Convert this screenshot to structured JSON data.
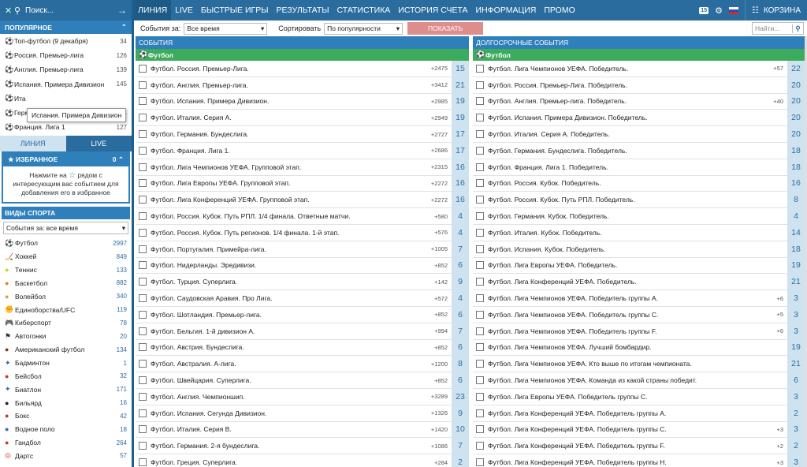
{
  "search": {
    "placeholder": "Поиск..."
  },
  "popular": {
    "title": "ПОПУЛЯРНОЕ",
    "items": [
      {
        "name": "Топ-футбол (9 декабря)",
        "count": "34"
      },
      {
        "name": "Россия. Премьер-лига",
        "count": "126"
      },
      {
        "name": "Англия. Премьер-лига",
        "count": "139"
      },
      {
        "name": "Испания. Примера Дивизион",
        "count": "145"
      },
      {
        "name": "Ита",
        "count": ""
      },
      {
        "name": "Германия. Бундеслига",
        "count": "134"
      },
      {
        "name": "Франция. Лига 1",
        "count": "127"
      }
    ],
    "tooltip": "Испания. Примера Дивизион"
  },
  "side_tabs": {
    "line": "ЛИНИЯ",
    "live": "LIVE"
  },
  "favorites": {
    "title": "ИЗБРАННОЕ",
    "count": "0",
    "text_a": "Нажмите на",
    "text_b": "рядом с интересующим вас событием для добавления его в избранное"
  },
  "sports": {
    "title": "ВИДЫ СПОРТА",
    "period": "События за: все время",
    "items": [
      {
        "name": "Футбол",
        "count": "2997",
        "icon": "⚽",
        "color": "#2fa34b"
      },
      {
        "name": "Хоккей",
        "count": "849",
        "icon": "🏒",
        "color": "#2e6da4"
      },
      {
        "name": "Теннис",
        "count": "133",
        "icon": "●",
        "color": "#c9d52b"
      },
      {
        "name": "Баскетбол",
        "count": "882",
        "icon": "●",
        "color": "#e8821e"
      },
      {
        "name": "Волейбол",
        "count": "340",
        "icon": "●",
        "color": "#d8a23c"
      },
      {
        "name": "Единоборства/UFC",
        "count": "119",
        "icon": "✊",
        "color": "#c0392b"
      },
      {
        "name": "Киберспорт",
        "count": "78",
        "icon": "🎮",
        "color": "#c0392b"
      },
      {
        "name": "Автогонки",
        "count": "20",
        "icon": "⚑",
        "color": "#333"
      },
      {
        "name": "Американский футбол",
        "count": "134",
        "icon": "●",
        "color": "#7a3b1e"
      },
      {
        "name": "Бадминтон",
        "count": "1",
        "icon": "✦",
        "color": "#2e6da4"
      },
      {
        "name": "Бейсбол",
        "count": "32",
        "icon": "●",
        "color": "#c0392b"
      },
      {
        "name": "Биатлон",
        "count": "171",
        "icon": "✦",
        "color": "#2e6da4"
      },
      {
        "name": "Бильярд",
        "count": "16",
        "icon": "●",
        "color": "#222"
      },
      {
        "name": "Бокс",
        "count": "42",
        "icon": "●",
        "color": "#c0392b"
      },
      {
        "name": "Водное поло",
        "count": "18",
        "icon": "●",
        "color": "#2e6da4"
      },
      {
        "name": "Гандбол",
        "count": "264",
        "icon": "●",
        "color": "#c0392b"
      },
      {
        "name": "Дартс",
        "count": "57",
        "icon": "◎",
        "color": "#c0392b"
      }
    ]
  },
  "topnav": {
    "items": [
      "ЛИНИЯ",
      "LIVE",
      "БЫСТРЫЕ ИГРЫ",
      "РЕЗУЛЬТАТЫ",
      "СТАТИСТИКА",
      "ИСТОРИЯ СЧЕТА",
      "ИНФОРМАЦИЯ",
      "ПРОМО"
    ],
    "badge": "15",
    "cart": "КОРЗИНА"
  },
  "filter": {
    "events_label": "События за:",
    "events_value": "Все время",
    "sort_label": "Сортировать",
    "sort_value": "По популярности",
    "show_button": "ПОКАЗАТЬ",
    "search_placeholder": "Найти..."
  },
  "events": {
    "title": "СОБЫТИЯ",
    "sport": "Футбол",
    "rows": [
      {
        "name": "Футбол. Россия. Премьер-Лига.",
        "plus": "+2475",
        "count": "15"
      },
      {
        "name": "Футбол. Англия. Премьер-лига.",
        "plus": "+3412",
        "count": "21"
      },
      {
        "name": "Футбол. Испания. Примера Дивизион.",
        "plus": "+2985",
        "count": "19"
      },
      {
        "name": "Футбол. Италия. Серия А.",
        "plus": "+2949",
        "count": "19"
      },
      {
        "name": "Футбол. Германия. Бундеслига.",
        "plus": "+2727",
        "count": "17"
      },
      {
        "name": "Футбол. Франция. Лига 1.",
        "plus": "+2686",
        "count": "17"
      },
      {
        "name": "Футбол. Лига Чемпионов УЕФА. Групповой этап.",
        "plus": "+2315",
        "count": "16"
      },
      {
        "name": "Футбол. Лига Европы УЕФА. Групповой этап.",
        "plus": "+2272",
        "count": "16"
      },
      {
        "name": "Футбол. Лига Конференций УЕФА. Групповой этап.",
        "plus": "+2272",
        "count": "16"
      },
      {
        "name": "Футбол. Россия. Кубок. Путь РПЛ. 1/4 финала. Ответные матчи.",
        "plus": "+580",
        "count": "4"
      },
      {
        "name": "Футбол. Россия. Кубок. Путь регионов. 1/4 финала. 1-й этап.",
        "plus": "+576",
        "count": "4"
      },
      {
        "name": "Футбол. Португалия. Примейра-лига.",
        "plus": "+1005",
        "count": "7"
      },
      {
        "name": "Футбол. Нидерланды. Эредивизи.",
        "plus": "+852",
        "count": "6"
      },
      {
        "name": "Футбол. Турция. Суперлига.",
        "plus": "+142",
        "count": "9"
      },
      {
        "name": "Футбол. Саудовская Аравия. Про Лига.",
        "plus": "+572",
        "count": "4"
      },
      {
        "name": "Футбол. Шотландия. Премьер-лига.",
        "plus": "+852",
        "count": "6"
      },
      {
        "name": "Футбол. Бельгия. 1-й дивизион А.",
        "plus": "+994",
        "count": "7"
      },
      {
        "name": "Футбол. Австрия. Бундеслига.",
        "plus": "+852",
        "count": "6"
      },
      {
        "name": "Футбол. Австралия. А-лига.",
        "plus": "+1200",
        "count": "8"
      },
      {
        "name": "Футбол. Швейцария. Суперлига.",
        "plus": "+852",
        "count": "6"
      },
      {
        "name": "Футбол. Англия. Чемпионшип.",
        "plus": "+3289",
        "count": "23"
      },
      {
        "name": "Футбол. Испания. Сегунда Дивизион.",
        "plus": "+1326",
        "count": "9"
      },
      {
        "name": "Футбол. Италия. Серия B.",
        "plus": "+1420",
        "count": "10"
      },
      {
        "name": "Футбол. Германия. 2-я бундеслига.",
        "plus": "+1086",
        "count": "7"
      },
      {
        "name": "Футбол. Греция. Суперлига.",
        "plus": "+284",
        "count": "2"
      }
    ]
  },
  "longterm": {
    "title": "ДОЛГОСРОЧНЫЕ СОБЫТИЯ",
    "sport": "Футбол",
    "rows": [
      {
        "name": "Футбол. Лига Чемпионов УЕФА. Победитель.",
        "plus": "+57",
        "count": "22"
      },
      {
        "name": "Футбол. Россия. Премьер-Лига. Победитель.",
        "plus": "",
        "count": "20"
      },
      {
        "name": "Футбол. Англия. Премьер-лига. Победитель.",
        "plus": "+40",
        "count": "20"
      },
      {
        "name": "Футбол. Испания. Примера Дивизион. Победитель.",
        "plus": "",
        "count": "20"
      },
      {
        "name": "Футбол. Италия. Серия А. Победитель.",
        "plus": "",
        "count": "20"
      },
      {
        "name": "Футбол. Германия. Бундеслига. Победитель.",
        "plus": "",
        "count": "18"
      },
      {
        "name": "Футбол. Франция. Лига 1. Победитель.",
        "plus": "",
        "count": "18"
      },
      {
        "name": "Футбол. Россия. Кубок. Победитель.",
        "plus": "",
        "count": "16"
      },
      {
        "name": "Футбол. Россия. Кубок. Путь РПЛ. Победитель.",
        "plus": "",
        "count": "8"
      },
      {
        "name": "Футбол. Германия. Кубок. Победитель.",
        "plus": "",
        "count": "4"
      },
      {
        "name": "Футбол. Италия. Кубок. Победитель.",
        "plus": "",
        "count": "14"
      },
      {
        "name": "Футбол. Испания. Кубок. Победитель.",
        "plus": "",
        "count": "18"
      },
      {
        "name": "Футбол. Лига Европы УЕФА. Победитель.",
        "plus": "",
        "count": "19"
      },
      {
        "name": "Футбол. Лига Конференций УЕФА. Победитель.",
        "plus": "",
        "count": "21"
      },
      {
        "name": "Футбол. Лига Чемпионов УЕФА. Победитель группы А.",
        "plus": "+6",
        "count": "3"
      },
      {
        "name": "Футбол. Лига Чемпионов УЕФА. Победитель группы С.",
        "plus": "+5",
        "count": "3"
      },
      {
        "name": "Футбол. Лига Чемпионов УЕФА. Победитель группы F.",
        "plus": "+6",
        "count": "3"
      },
      {
        "name": "Футбол. Лига Чемпионов УЕФА. Лучший бомбардир.",
        "plus": "",
        "count": "19"
      },
      {
        "name": "Футбол. Лига Чемпионов УЕФА. Кто выше по итогам чемпионата.",
        "plus": "",
        "count": "21"
      },
      {
        "name": "Футбол. Лига Чемпионов УЕФА. Команда из какой страны победит.",
        "plus": "",
        "count": "6"
      },
      {
        "name": "Футбол. Лига Европы УЕФА. Победитель группы С.",
        "plus": "",
        "count": "3"
      },
      {
        "name": "Футбол. Лига Конференций УЕФА. Победитель группы А.",
        "plus": "",
        "count": "2"
      },
      {
        "name": "Футбол. Лига Конференций УЕФА. Победитель группы С.",
        "plus": "+3",
        "count": "3"
      },
      {
        "name": "Футбол. Лига Конференций УЕФА. Победитель группы F.",
        "plus": "+2",
        "count": "2"
      },
      {
        "name": "Футбол. Лига Конференций УЕФА. Победитель группы H.",
        "plus": "+3",
        "count": "3"
      }
    ]
  }
}
